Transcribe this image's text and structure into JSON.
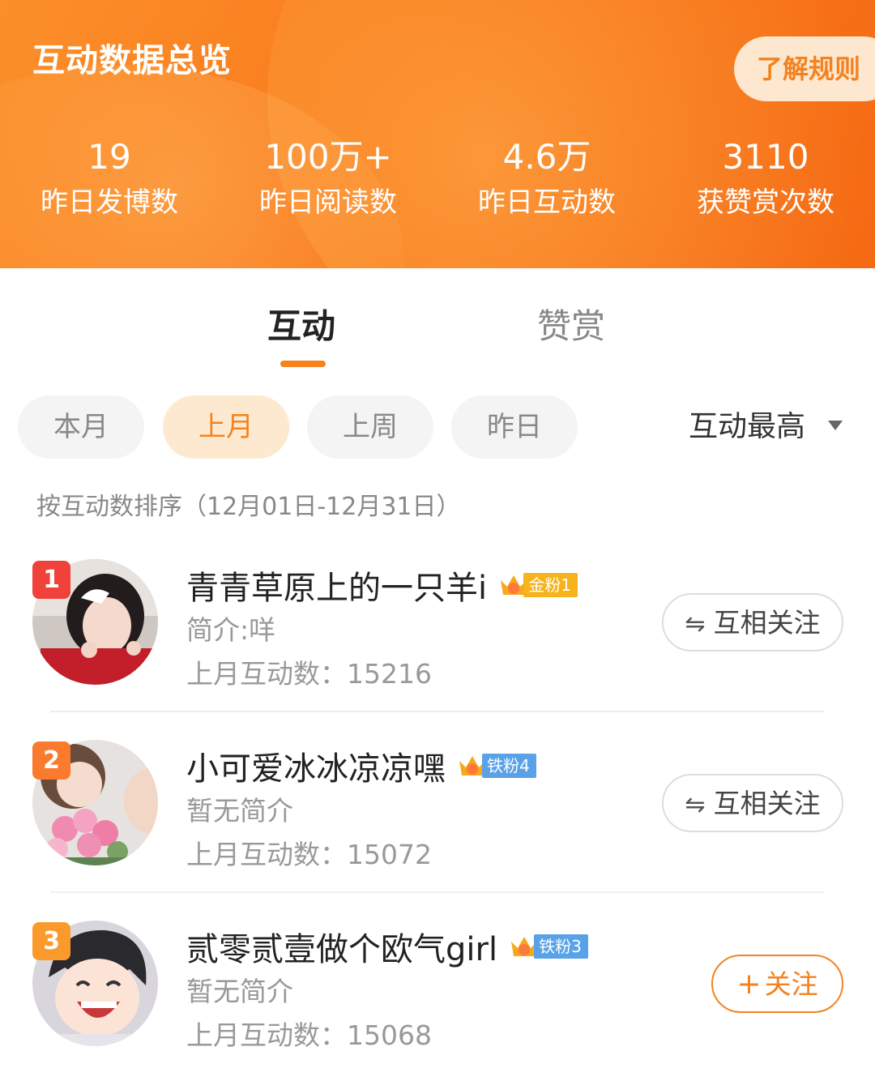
{
  "header": {
    "title": "互动数据总览",
    "rules_button": "了解规则",
    "stats": [
      {
        "value": "19",
        "label": "昨日发博数"
      },
      {
        "value": "100万+",
        "label": "昨日阅读数"
      },
      {
        "value": "4.6万",
        "label": "昨日互动数"
      },
      {
        "value": "3110",
        "label": "获赞赏次数"
      }
    ]
  },
  "tabs": {
    "active": "互动",
    "inactive": "赞赏"
  },
  "filters": {
    "chips": [
      "本月",
      "上月",
      "上周",
      "昨日"
    ],
    "selected": "上月",
    "sort_label": "互动最高"
  },
  "sort_description": "按互动数排序（12月01日-12月31日）",
  "users": [
    {
      "rank": "1",
      "name": "青青草原上的一只羊i",
      "fan_badge": "金粉1",
      "fan_badge_color": "#f7b31b",
      "intro": "简介:咩",
      "count_label": "上月互动数：",
      "count": "15216",
      "action": "互相关注",
      "action_icon": "mutual-arrows-icon"
    },
    {
      "rank": "2",
      "name": "小可爱冰冰凉凉嘿",
      "fan_badge": "铁粉4",
      "fan_badge_color": "#5aa2e8",
      "intro": "暂无简介",
      "count_label": "上月互动数：",
      "count": "15072",
      "action": "互相关注",
      "action_icon": "mutual-arrows-icon"
    },
    {
      "rank": "3",
      "name": "贰零贰壹做个欧气girl",
      "fan_badge": "铁粉3",
      "fan_badge_color": "#5aa2e8",
      "intro": "暂无简介",
      "count_label": "上月互动数：",
      "count": "15068",
      "action": "关注",
      "action_icon": "plus-icon"
    }
  ],
  "colors": {
    "accent": "#f5821f",
    "rank1": "#f0413a",
    "rank2": "#fa7a2e",
    "rank3": "#fb9a2c"
  }
}
